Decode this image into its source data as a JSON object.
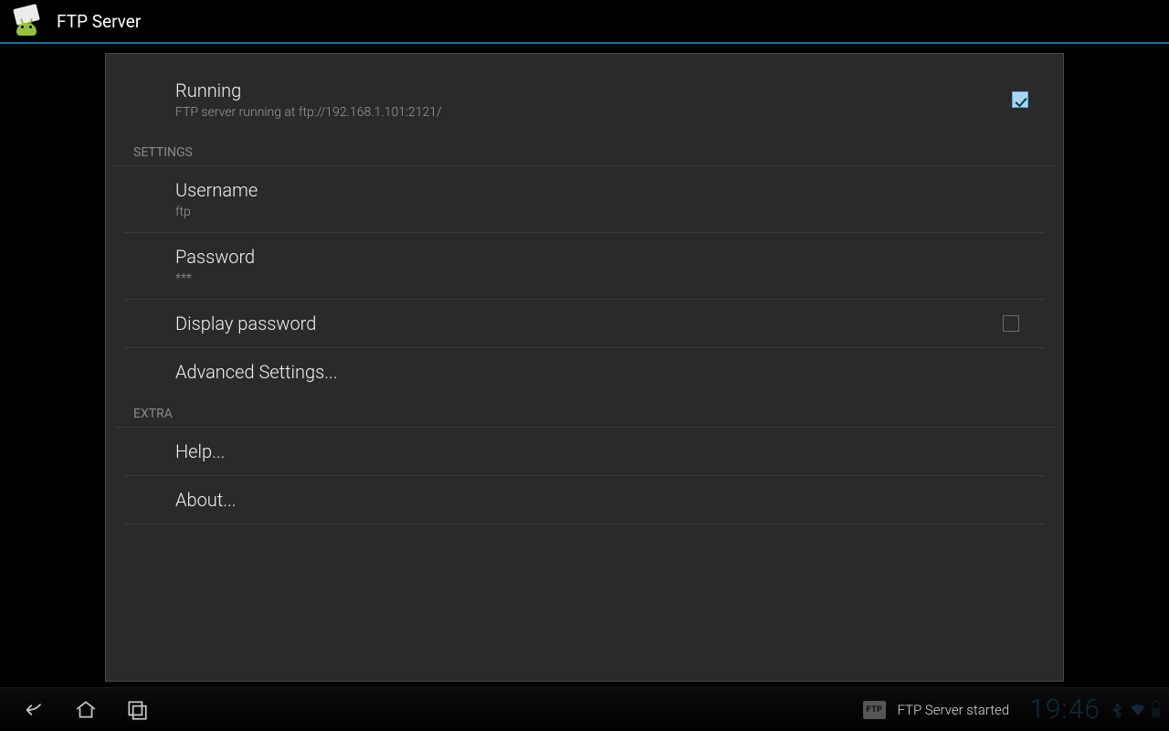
{
  "header": {
    "title": "FTP Server"
  },
  "running": {
    "title": "Running",
    "subtitle": "FTP server running at ftp://192.168.1.101:2121/",
    "checked": true
  },
  "sections": {
    "settings_label": "Settings",
    "extra_label": "Extra"
  },
  "settings": {
    "username": {
      "title": "Username",
      "value": "ftp"
    },
    "password": {
      "title": "Password",
      "value": "***"
    },
    "display_password": {
      "title": "Display password",
      "checked": false
    },
    "advanced": {
      "title": "Advanced Settings..."
    }
  },
  "extra": {
    "help": {
      "title": "Help..."
    },
    "about": {
      "title": "About..."
    }
  },
  "systembar": {
    "notif_badge": "FTP",
    "notif_text": "FTP Server started",
    "clock": "19:46"
  }
}
